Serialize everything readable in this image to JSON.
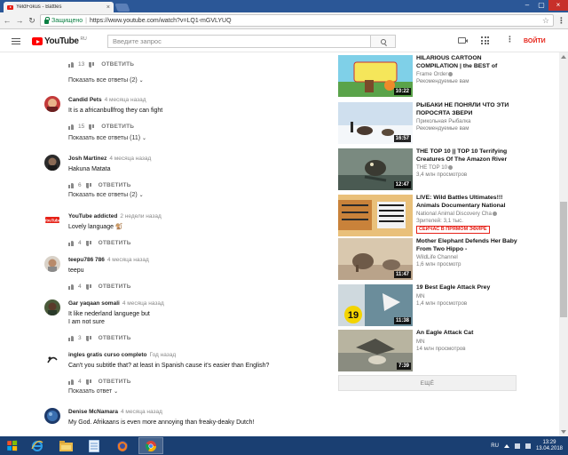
{
  "browser": {
    "tab_title": "YeldFokus - Battles",
    "tab_close": "×",
    "window_controls": [
      "–",
      "▢",
      "×"
    ],
    "nav": {
      "back": "←",
      "forward": "→",
      "reload": "↻"
    },
    "secure_label": "Защищено",
    "url_separator": "|",
    "url": "https://www.youtube.com/watch?v=LQ1-mGVLYUQ",
    "bookmark_star": "☆",
    "menu_dots": "⋮"
  },
  "masthead": {
    "logo_text": "YouTube",
    "logo_region": "RU",
    "search_placeholder": "Введите запрос",
    "more_label": "⋮",
    "signin_label": "ВОЙТИ"
  },
  "reply_label": "ОТВЕТИТЬ",
  "comments": [
    {
      "id": "c0",
      "author": "",
      "time": "",
      "text": "",
      "likes": "13",
      "show_replies": "Показать все ответы (2)"
    },
    {
      "id": "c1",
      "author": "Candid Pets",
      "time": "4 месяца назад",
      "text": "It is a africanbullfrog they can fight",
      "likes": "15",
      "show_replies": "Показать все ответы (11)"
    },
    {
      "id": "c2",
      "author": "Josh Martinez",
      "time": "4 месяца назад",
      "text": "Hakuna Matata",
      "likes": "6",
      "show_replies": "Показать все ответы (2)"
    },
    {
      "id": "c3",
      "author": "YouTube addicted",
      "time": "2 недели назад",
      "text": "Lovely language 🐒",
      "likes": "4",
      "show_replies": ""
    },
    {
      "id": "c4",
      "author": "teepu786 786",
      "time": "4 месяца назад",
      "text": "teepu",
      "likes": "4",
      "show_replies": ""
    },
    {
      "id": "c5",
      "author": "Gar yaqaan somali",
      "time": "4 месяца назад",
      "text": "It like nederland languege  but",
      "text2": "I am not sure",
      "likes": "3",
      "show_replies": ""
    },
    {
      "id": "c6",
      "author": "ingles gratis curso completo",
      "time": "Год назад",
      "text": "Can't you subtitle that? at least in Spanish cause it's easier than English?",
      "likes": "4",
      "show_replies": "Показать ответ"
    },
    {
      "id": "c7",
      "author": "Denise McNamara",
      "time": "4 месяца назад",
      "text": "My God. Afrikaans is even more annoying than freaky-deaky Dutch!",
      "likes": "",
      "show_replies": ""
    }
  ],
  "recommendations": [
    {
      "title": "HILARIOUS CARTOON COMPILATION | the BEST of",
      "channel": "Frame Order",
      "verified": true,
      "meta": "Рекомендуемые вам",
      "duration": "10:22",
      "thumb_colors": [
        "#7fd0e8",
        "#f5e65a",
        "#5aa34a"
      ]
    },
    {
      "title": "РЫБАКИ НЕ ПОНЯЛИ ЧТО ЭТИ ПОРОСЯТА ЗВЕРИ",
      "channel": "Прикольная Рыбалка",
      "verified": false,
      "meta": "Рекомендуемые вам",
      "duration": "16:57",
      "thumb_colors": [
        "#cfdfee",
        "#f4f7fa",
        "#4a3a30"
      ]
    },
    {
      "title": "THE TOP 10 || TOP 10 Terrifying Creatures Of The Amazon River",
      "channel": "THE TOP 10",
      "verified": true,
      "meta": "3,4 млн просмотров",
      "duration": "12:47",
      "thumb_colors": [
        "#7a8a80",
        "#4a5a52",
        "#2f3a35"
      ]
    },
    {
      "title": "LIVE: Wild Battles Ultimates!!! Animals Documentary National",
      "channel": "National Animal Discovery Cha",
      "verified": true,
      "meta": "Зрителей: 3,1 тыс.",
      "live": "СЕЙЧАС В ПРЯМОМ ЭФИРЕ",
      "duration": "",
      "thumb_colors": [
        "#c9823a",
        "#e9c07a",
        "#2b2b2b"
      ]
    },
    {
      "title": "Mother Elephant Defends Her Baby From Two Hippo -",
      "channel": "WildLife Channel",
      "verified": false,
      "meta": "1,6 млн просмотр",
      "duration": "11:47",
      "thumb_colors": [
        "#b9a38a",
        "#d9c8ae",
        "#6e5a48"
      ]
    },
    {
      "title": "19 Best Eagle Attack Prey",
      "channel": "MN",
      "verified": false,
      "meta": "1,4 млн просмотров",
      "duration": "11:38",
      "badge": "19",
      "thumb_colors": [
        "#6b8d9b",
        "#cfd9de",
        "#f3d400"
      ]
    },
    {
      "title": "An Eagle Attack Cat",
      "channel": "MN",
      "verified": false,
      "meta": "14 млн просмотров",
      "duration": "7:39",
      "thumb_colors": [
        "#8a8c80",
        "#b8b4a0",
        "#4e4e46"
      ]
    }
  ],
  "show_more_label": "ЕЩЁ",
  "taskbar": {
    "apps": [
      "ie",
      "explorer",
      "notepad",
      "firefox",
      "chrome"
    ],
    "language": "RU",
    "time": "13:29",
    "date": "13.04.2018"
  }
}
